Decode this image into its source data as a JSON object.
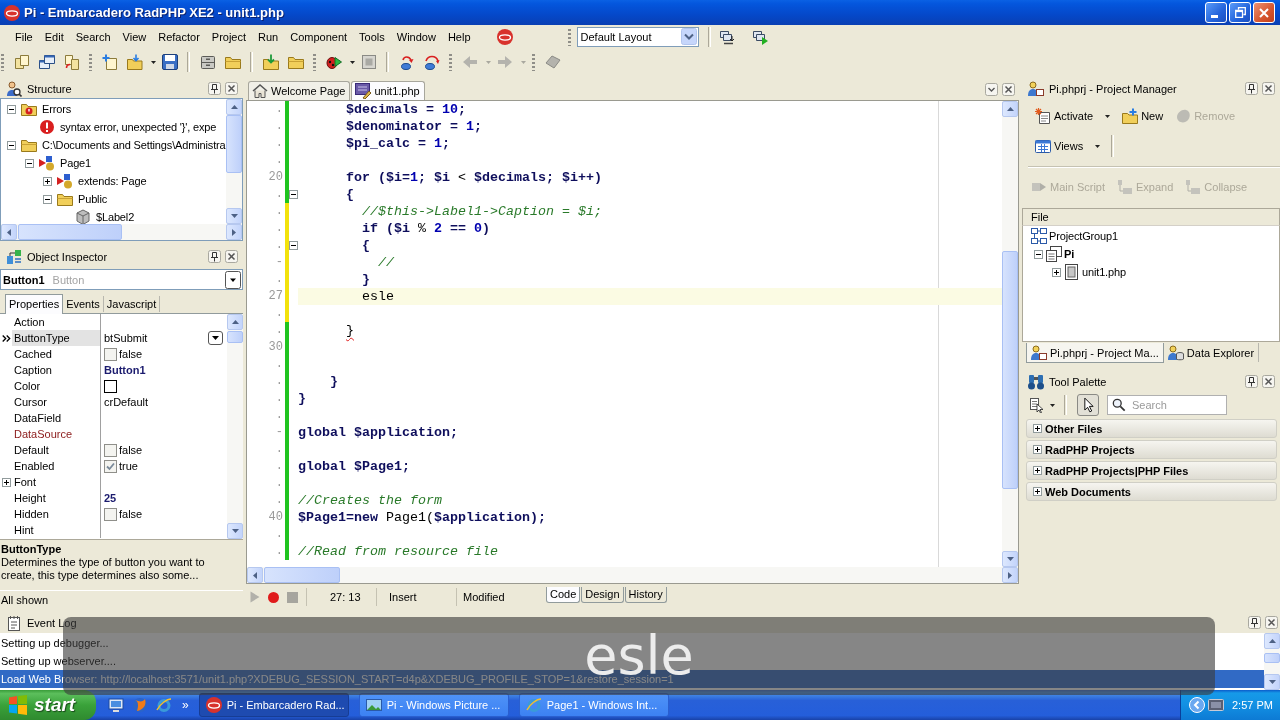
{
  "window": {
    "title": "Pi - Embarcadero RadPHP XE2 - unit1.php"
  },
  "menu": [
    "File",
    "Edit",
    "Search",
    "View",
    "Refactor",
    "Project",
    "Run",
    "Component",
    "Tools",
    "Window",
    "Help"
  ],
  "layout_selector": {
    "value": "Default Layout"
  },
  "toolbar": {
    "back_disabled": true,
    "forward_disabled": true
  },
  "structure": {
    "title": "Structure",
    "tree": [
      {
        "label": "Errors",
        "kind": "error-folder",
        "expanded": true,
        "children": [
          {
            "label": "syntax error, unexpected '}', expe",
            "kind": "error"
          }
        ]
      },
      {
        "label": "C:\\Documents and Settings\\Administra",
        "kind": "folder",
        "expanded": true,
        "children": [
          {
            "label": "Page1",
            "kind": "class",
            "expanded": true,
            "children": [
              {
                "label": "extends: Page",
                "kind": "class",
                "expanded": false
              },
              {
                "label": "Public",
                "kind": "folder",
                "expanded": true,
                "children": [
                  {
                    "label": "$Label2",
                    "kind": "field"
                  }
                ]
              }
            ]
          }
        ]
      }
    ]
  },
  "object_inspector": {
    "title": "Object Inspector",
    "component": {
      "name": "Button1",
      "type": "Button"
    },
    "tabs": [
      {
        "label": "Properties",
        "selected": true
      },
      {
        "label": "Events",
        "selected": false
      },
      {
        "label": "Javascript",
        "selected": false
      }
    ],
    "properties": [
      {
        "name": "Action",
        "kind": "text",
        "selected": false
      },
      {
        "name": "ButtonType",
        "kind": "text",
        "value": "btSubmit",
        "modified": false,
        "selected": true
      },
      {
        "name": "Cached",
        "kind": "check",
        "value": "false",
        "checked": false,
        "modified": false,
        "selected": false
      },
      {
        "name": "Caption",
        "kind": "text",
        "value": "Button1",
        "modified": true,
        "selected": false
      },
      {
        "name": "Color",
        "kind": "swatch",
        "selected": false
      },
      {
        "name": "Cursor",
        "kind": "text",
        "value": "crDefault",
        "modified": false,
        "selected": false
      },
      {
        "name": "DataField",
        "kind": "text",
        "selected": false
      },
      {
        "name": "DataSource",
        "kind": "reference",
        "selected": false
      },
      {
        "name": "Default",
        "kind": "check",
        "value": "false",
        "checked": false,
        "modified": false,
        "selected": false
      },
      {
        "name": "Enabled",
        "kind": "check",
        "value": "true",
        "checked": true,
        "modified": false,
        "selected": false
      },
      {
        "name": "Font",
        "kind": "group",
        "expanded": false,
        "selected": false
      },
      {
        "name": "Height",
        "kind": "text",
        "value": "25",
        "modified": true,
        "selected": false
      },
      {
        "name": "Hidden",
        "kind": "check",
        "value": "false",
        "checked": false,
        "modified": false,
        "selected": false
      },
      {
        "name": "Hint",
        "kind": "text",
        "selected": false
      }
    ],
    "help": {
      "title": "ButtonType",
      "text": "Determines the type of button you want to create, this type determines also some..."
    },
    "status": "All shown"
  },
  "editor": {
    "tabs": [
      {
        "label": "Welcome Page",
        "kind": "start_page",
        "selected": false
      },
      {
        "label": "unit1.php",
        "kind": "source_file",
        "selected": true
      }
    ],
    "lines": [
      {
        "gutter": ".",
        "modified": false,
        "current": false,
        "fold": false,
        "error": false,
        "tokens": [
          {
            "text": "      $decimals = ",
            "kind": "code"
          },
          {
            "text": "10",
            "kind": "num"
          },
          {
            "text": ";",
            "kind": "code"
          }
        ]
      },
      {
        "gutter": ".",
        "modified": false,
        "current": false,
        "fold": false,
        "error": false,
        "tokens": [
          {
            "text": "      $denominator = ",
            "kind": "code"
          },
          {
            "text": "1",
            "kind": "num"
          },
          {
            "text": ";",
            "kind": "code"
          }
        ]
      },
      {
        "gutter": ".",
        "modified": false,
        "current": false,
        "fold": false,
        "error": false,
        "tokens": [
          {
            "text": "      $pi_calc = ",
            "kind": "code"
          },
          {
            "text": "1",
            "kind": "num"
          },
          {
            "text": ";",
            "kind": "code"
          }
        ]
      },
      {
        "gutter": ".",
        "modified": false,
        "current": false,
        "fold": false
      },
      {
        "gutter": "20",
        "modified": false,
        "current": false,
        "fold": false,
        "error": false,
        "tokens": [
          {
            "text": "      for ($i=",
            "kind": "code"
          },
          {
            "text": "1",
            "kind": "num"
          },
          {
            "text": "; $i ",
            "kind": "code"
          },
          {
            "text": "<",
            "kind": "plain"
          },
          {
            "text": " $decimals; $i++)",
            "kind": "code"
          }
        ]
      },
      {
        "gutter": ".",
        "modified": false,
        "current": false,
        "fold": true,
        "error": false,
        "tokens": [
          {
            "text": "      {",
            "kind": "code"
          }
        ]
      },
      {
        "gutter": ".",
        "modified": true,
        "current": false,
        "fold": false,
        "error": false,
        "tokens": [
          {
            "text": "        //$this->Label1->Caption = $i;",
            "kind": "comment"
          }
        ]
      },
      {
        "gutter": ".",
        "modified": true,
        "current": false,
        "fold": false,
        "error": false,
        "tokens": [
          {
            "text": "        if ($i ",
            "kind": "code"
          },
          {
            "text": "% ",
            "kind": "plain"
          },
          {
            "text": "2",
            "kind": "num"
          },
          {
            "text": " == ",
            "kind": "code"
          },
          {
            "text": "0",
            "kind": "num"
          },
          {
            "text": ")",
            "kind": "code"
          }
        ]
      },
      {
        "gutter": ".",
        "modified": true,
        "current": false,
        "fold": true,
        "error": false,
        "tokens": [
          {
            "text": "        {",
            "kind": "code"
          }
        ]
      },
      {
        "gutter": "-",
        "modified": true,
        "current": false,
        "fold": false,
        "error": false,
        "tokens": [
          {
            "text": "          //",
            "kind": "comment"
          }
        ]
      },
      {
        "gutter": ".",
        "modified": true,
        "current": false,
        "fold": false,
        "error": false,
        "tokens": [
          {
            "text": "        }",
            "kind": "code"
          }
        ]
      },
      {
        "gutter": "27",
        "modified": true,
        "current": true,
        "fold": false,
        "error": false,
        "tokens": [
          {
            "text": "        esle",
            "kind": "plain"
          }
        ]
      },
      {
        "gutter": ".",
        "modified": true,
        "current": false,
        "fold": false
      },
      {
        "gutter": ".",
        "modified": false,
        "current": false,
        "fold": false,
        "error": true,
        "tokens": [
          {
            "text": "      }",
            "kind": "plain"
          }
        ]
      },
      {
        "gutter": "30",
        "modified": false,
        "current": false,
        "fold": false
      },
      {
        "gutter": ".",
        "modified": false,
        "current": false,
        "fold": false
      },
      {
        "gutter": ".",
        "modified": false,
        "current": false,
        "fold": false,
        "error": false,
        "tokens": [
          {
            "text": "    }",
            "kind": "code"
          }
        ]
      },
      {
        "gutter": ".",
        "modified": false,
        "current": false,
        "fold": false,
        "error": false,
        "tokens": [
          {
            "text": "}",
            "kind": "code"
          }
        ]
      },
      {
        "gutter": ".",
        "modified": false,
        "current": false,
        "fold": false
      },
      {
        "gutter": "-",
        "modified": false,
        "current": false,
        "fold": false,
        "error": false,
        "tokens": [
          {
            "text": "global $application;",
            "kind": "code"
          }
        ]
      },
      {
        "gutter": ".",
        "modified": false,
        "current": false,
        "fold": false
      },
      {
        "gutter": ".",
        "modified": false,
        "current": false,
        "fold": false,
        "error": false,
        "tokens": [
          {
            "text": "global $Page1;",
            "kind": "code"
          }
        ]
      },
      {
        "gutter": ".",
        "modified": false,
        "current": false,
        "fold": false
      },
      {
        "gutter": ".",
        "modified": false,
        "current": false,
        "fold": false,
        "error": false,
        "tokens": [
          {
            "text": "//Creates the form",
            "kind": "comment"
          }
        ]
      },
      {
        "gutter": "40",
        "modified": false,
        "current": false,
        "fold": false,
        "error": false,
        "tokens": [
          {
            "text": "$Page1=new ",
            "kind": "code"
          },
          {
            "text": "Page1(",
            "kind": "plain"
          },
          {
            "text": "$application);",
            "kind": "code"
          }
        ]
      },
      {
        "gutter": ".",
        "modified": false,
        "current": false,
        "fold": false
      },
      {
        "gutter": ".",
        "modified": false,
        "current": false,
        "fold": false,
        "error": false,
        "tokens": [
          {
            "text": "//Read from resource file",
            "kind": "comment"
          }
        ]
      }
    ],
    "status": {
      "position": "27: 13",
      "mode": "Insert",
      "state": "Modified"
    },
    "view_tabs": [
      {
        "label": "Code",
        "selected": true
      },
      {
        "label": "Design",
        "selected": false
      },
      {
        "label": "History",
        "selected": false
      }
    ]
  },
  "project_manager": {
    "title": "Pi.phprj - Project Manager",
    "actions": [
      {
        "label": "Activate",
        "disabled": false,
        "menu": true
      },
      {
        "label": "New",
        "disabled": false,
        "menu": false
      },
      {
        "label": "Remove",
        "disabled": true,
        "menu": false
      }
    ],
    "views": {
      "label": "Views",
      "menu": true
    },
    "tree_actions": [
      {
        "label": "Main Script",
        "disabled": true
      },
      {
        "label": "Expand",
        "disabled": true
      },
      {
        "label": "Collapse",
        "disabled": true
      }
    ],
    "column": "File",
    "tree": [
      {
        "label": "ProjectGroup1",
        "kind": "group",
        "active": false,
        "children": [
          {
            "label": "Pi",
            "kind": "project",
            "active": true,
            "expanded": true,
            "children": [
              {
                "label": "unit1.php",
                "kind": "file",
                "active": false,
                "expanded": false
              }
            ]
          }
        ]
      }
    ],
    "tabs": [
      {
        "label": "Pi.phprj - Project Ma...",
        "selected": true
      },
      {
        "label": "Data Explorer",
        "selected": false
      }
    ]
  },
  "tool_palette": {
    "title": "Tool Palette",
    "pointer_selected": true,
    "search": {
      "placeholder": "Search"
    },
    "categories": [
      {
        "label": "Other Files",
        "expanded": false
      },
      {
        "label": "RadPHP Projects",
        "expanded": false
      },
      {
        "label": "RadPHP Projects|PHP Files",
        "expanded": false
      },
      {
        "label": "Web Documents",
        "expanded": false
      }
    ]
  },
  "event_log": {
    "title": "Event Log",
    "entries": [
      {
        "text": "Setting up debugger...",
        "selected": false
      },
      {
        "text": "Setting up webserver....",
        "selected": false
      },
      {
        "text": "Load Web Browser: http://localhost:3571/unit1.php?XDEBUG_SESSION_START=d4p&XDEBUG_PROFILE_STOP=1&restore_session=1",
        "selected": true
      }
    ]
  },
  "caption_overlay": {
    "text": "esle"
  },
  "taskbar": {
    "start": "start",
    "quick_launch_more": "»",
    "tasks": [
      {
        "label": "Pi - Embarcadero Rad...",
        "selected": true
      },
      {
        "label": "Pi - Windows Picture ...",
        "selected": false
      },
      {
        "label": "Page1 - Windows Int...",
        "selected": false
      }
    ],
    "clock": "2:57 PM"
  }
}
